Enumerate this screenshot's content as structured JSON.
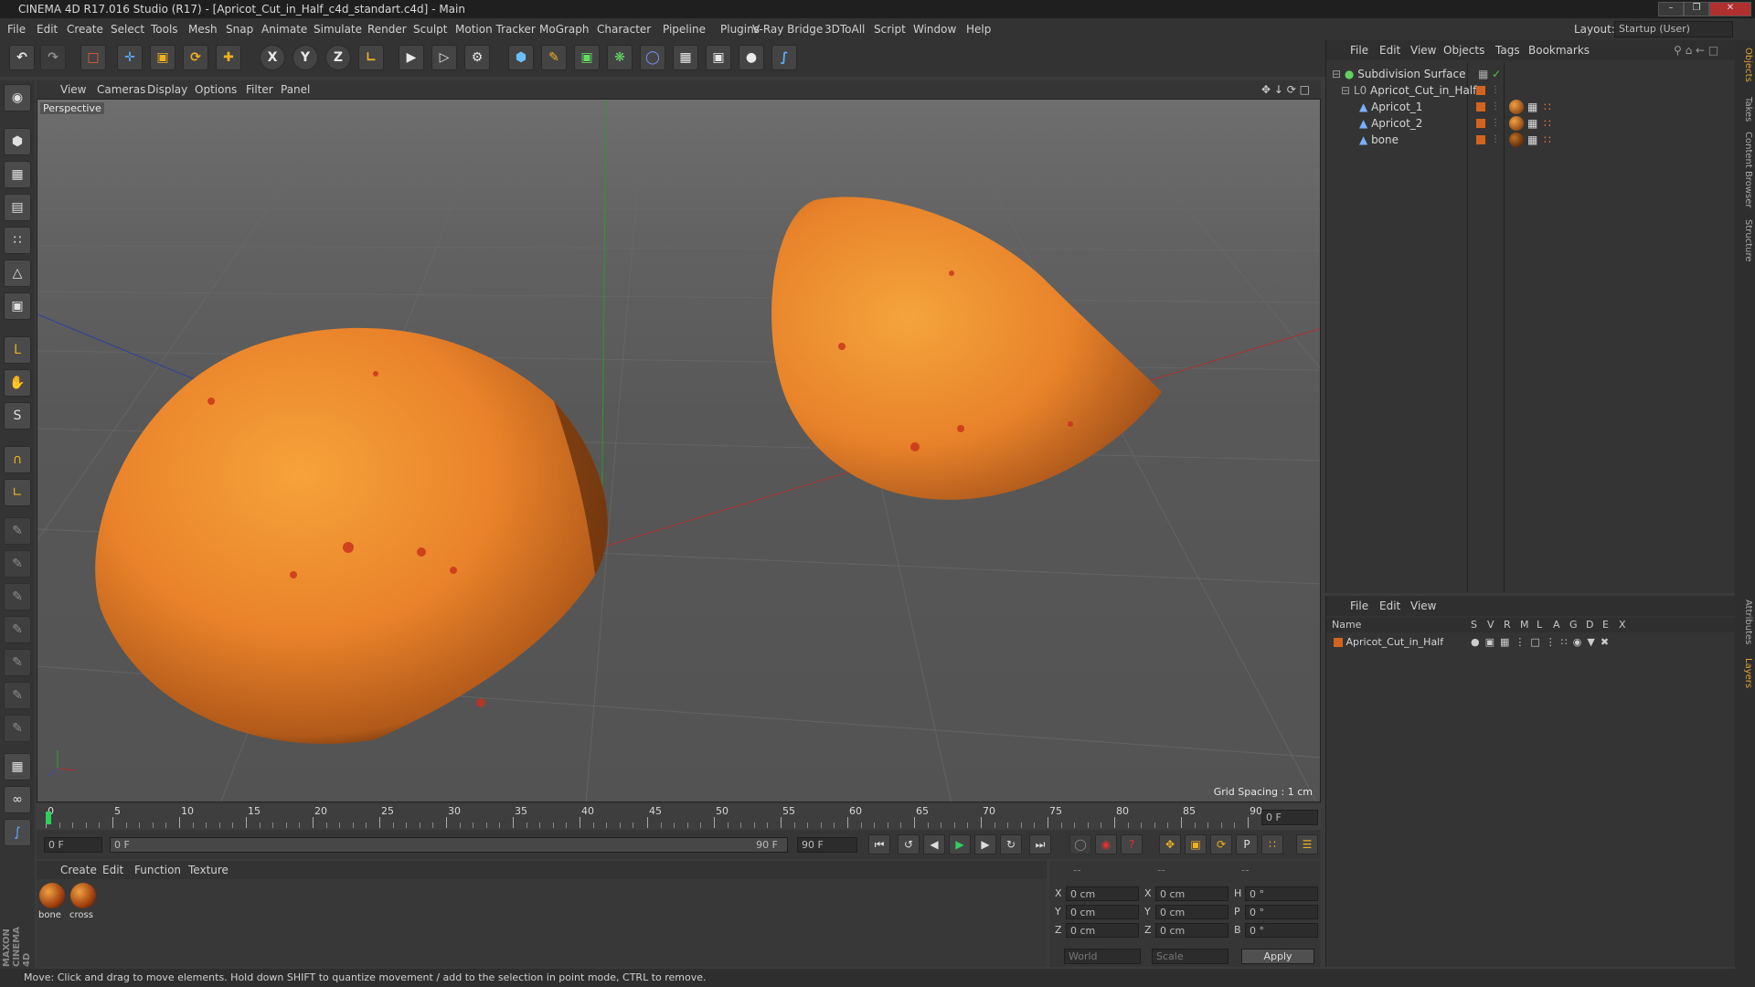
{
  "window": {
    "title": "CINEMA 4D R17.016 Studio (R17) - [Apricot_Cut_in_Half_c4d_standart.c4d] - Main",
    "layout_label": "Layout:",
    "layout_value": "Startup (User)"
  },
  "menu": [
    "File",
    "Edit",
    "Create",
    "Select",
    "Tools",
    "Mesh",
    "Snap",
    "Animate",
    "Simulate",
    "Render",
    "Sculpt",
    "Motion Tracker",
    "MoGraph",
    "Character",
    "Pipeline",
    "Plugins",
    "V-Ray Bridge",
    "3DToAll",
    "Script",
    "Window",
    "Help"
  ],
  "toolbar": {
    "x": "X",
    "y": "Y",
    "z": "Z"
  },
  "viewport": {
    "menu": [
      "View",
      "Cameras",
      "Display",
      "Options",
      "Filter",
      "Panel"
    ],
    "camera": "Perspective",
    "grid_spacing": "Grid Spacing : 1 cm"
  },
  "timeline": {
    "ticks": [
      "0",
      "5",
      "10",
      "15",
      "20",
      "25",
      "30",
      "35",
      "40",
      "45",
      "50",
      "55",
      "60",
      "65",
      "70",
      "75",
      "80",
      "85",
      "90"
    ],
    "current_frame": "0 F",
    "start": "0 F",
    "range_start": "0 F",
    "range_end": "90 F",
    "end": "90 F"
  },
  "objects": {
    "menu": [
      "File",
      "Edit",
      "View",
      "Objects",
      "Tags",
      "Bookmarks"
    ],
    "items": [
      {
        "name": "Subdivision Surface"
      },
      {
        "name": "Apricot_Cut_in_Half"
      },
      {
        "name": "Apricot_1"
      },
      {
        "name": "Apricot_2"
      },
      {
        "name": "bone"
      }
    ]
  },
  "layers": {
    "menu": [
      "File",
      "Edit",
      "View"
    ],
    "headers": [
      "Name",
      "S",
      "V",
      "R",
      "M",
      "L",
      "A",
      "G",
      "D",
      "E",
      "X"
    ],
    "row": "Apricot_Cut_in_Half"
  },
  "materials": {
    "menu": [
      "Create",
      "Edit",
      "Function",
      "Texture"
    ],
    "items": [
      {
        "name": "bone"
      },
      {
        "name": "cross"
      }
    ]
  },
  "coords": {
    "top": [
      "--",
      "--",
      "--"
    ],
    "rows": [
      {
        "a": "X",
        "av": "0 cm",
        "b": "X",
        "bv": "0 cm",
        "c": "H",
        "cv": "0 °"
      },
      {
        "a": "Y",
        "av": "0 cm",
        "b": "Y",
        "bv": "0 cm",
        "c": "P",
        "cv": "0 °"
      },
      {
        "a": "Z",
        "av": "0 cm",
        "b": "Z",
        "bv": "0 cm",
        "c": "B",
        "cv": "0 °"
      }
    ],
    "world": "World",
    "scale": "Scale",
    "apply": "Apply"
  },
  "right_tabs": [
    "Objects",
    "Takes",
    "Content Browser",
    "Structure",
    "Attributes",
    "Layers"
  ],
  "brand": "MAXON CINEMA 4D",
  "status": "Move: Click and drag to move elements. Hold down SHIFT to quantize movement / add to the selection in point mode, CTRL to remove."
}
